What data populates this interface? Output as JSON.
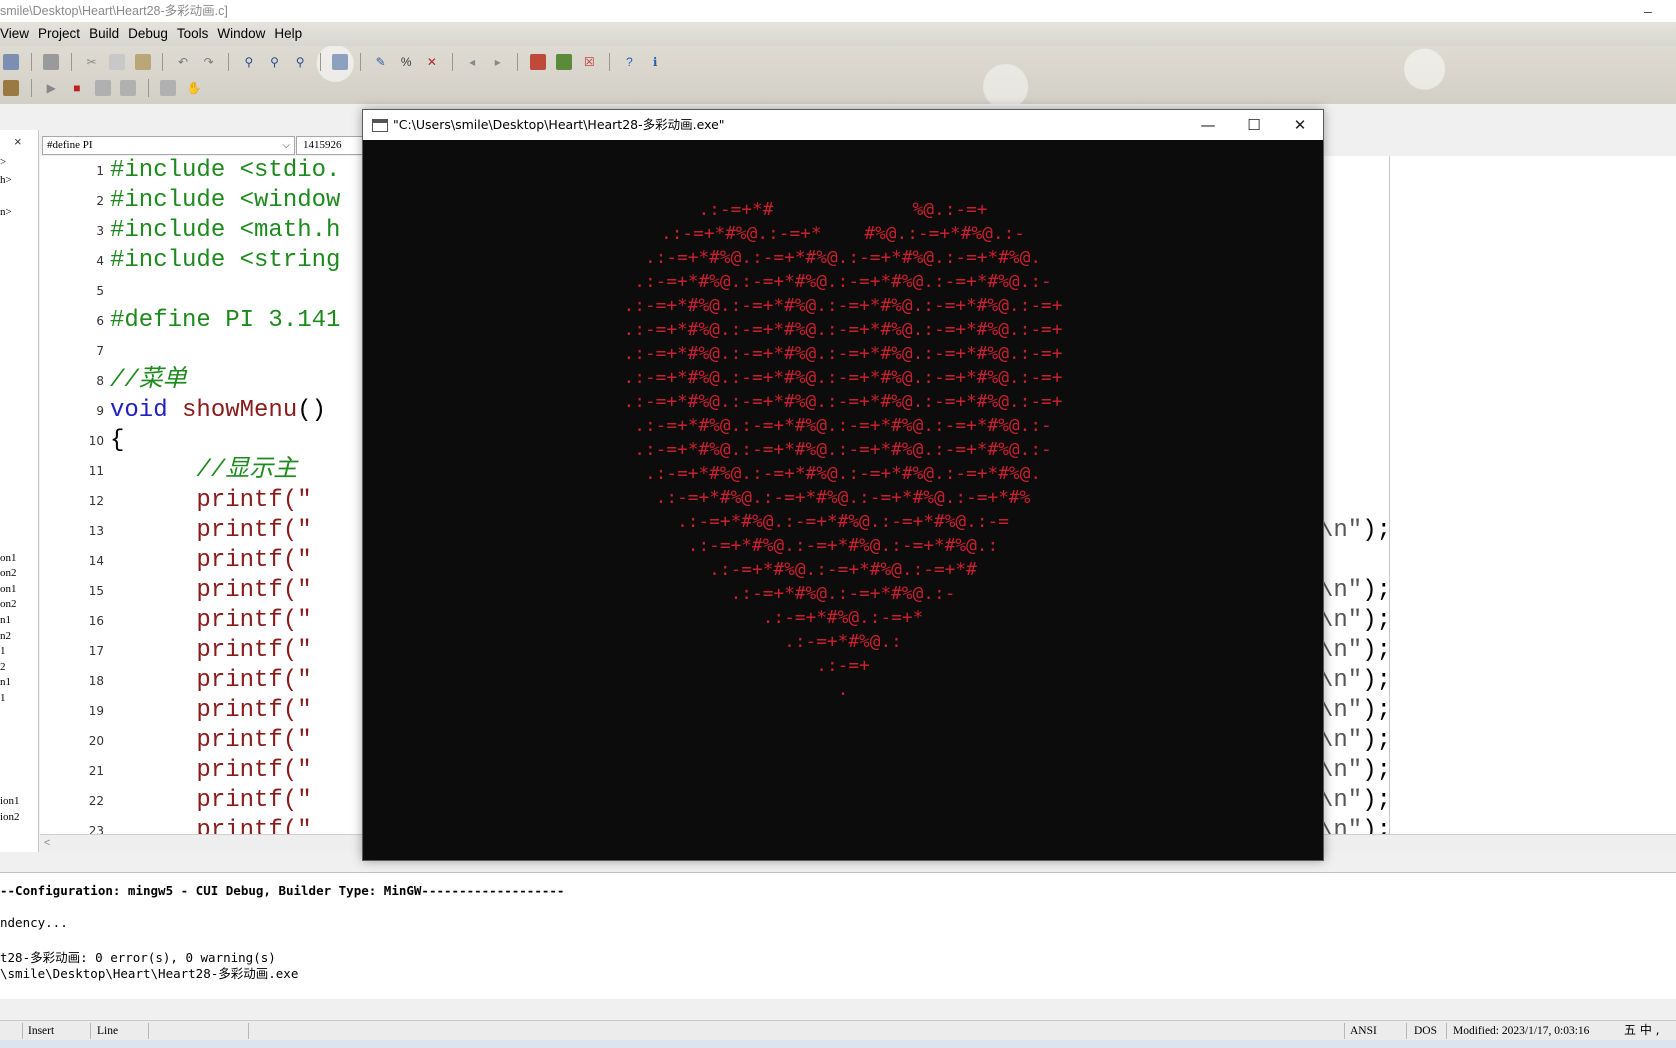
{
  "app": {
    "title_fragment": "smile\\Desktop\\Heart\\Heart28-多彩动画.c]",
    "minimize_glyph": "–"
  },
  "menu": [
    "View",
    "Project",
    "Build",
    "Debug",
    "Tools",
    "Window",
    "Help"
  ],
  "colors": {
    "console_bg": "#0c0c0c",
    "heart_red": "#c8202e",
    "preprocessor_green": "#1e8a1e",
    "keyword_blue": "#2020c0",
    "function_red": "#8b1a1a"
  },
  "left_panel": {
    "close_glyph": "×",
    "items": [
      ">",
      "h>",
      "n>",
      "on1",
      "on2",
      "on1",
      "on2",
      "n1",
      "n2",
      "1",
      "2",
      "n1",
      "1",
      "ion1",
      "ion2"
    ]
  },
  "codebar": {
    "define_selector": "#define PI",
    "value_box": "1415926"
  },
  "code_lines": [
    {
      "n": "1",
      "text": "#include <stdio.",
      "kind": "pre"
    },
    {
      "n": "2",
      "text": "#include <window",
      "kind": "pre"
    },
    {
      "n": "3",
      "text": "#include <math.h",
      "kind": "pre"
    },
    {
      "n": "4",
      "text": "#include <string",
      "kind": "pre"
    },
    {
      "n": "5",
      "text": "",
      "kind": "plain"
    },
    {
      "n": "6",
      "text": "#define PI 3.141",
      "kind": "pre"
    },
    {
      "n": "7",
      "text": "",
      "kind": "plain"
    },
    {
      "n": "8",
      "text": "//菜单",
      "kind": "comment"
    },
    {
      "n": "9",
      "kw": "void",
      "fn": " showMenu",
      "rest": "()",
      "kind": "decl"
    },
    {
      "n": "10",
      "text": "{",
      "kind": "plain"
    },
    {
      "n": "11",
      "text": "      //显示主",
      "kind": "comment"
    },
    {
      "n": "12",
      "text": "      printf(\"",
      "kind": "call"
    },
    {
      "n": "13",
      "text": "      printf(\"",
      "kind": "call"
    },
    {
      "n": "14",
      "text": "      printf(\"",
      "kind": "call"
    },
    {
      "n": "15",
      "text": "      printf(\"",
      "kind": "call"
    },
    {
      "n": "16",
      "text": "      printf(\"",
      "kind": "call"
    },
    {
      "n": "17",
      "text": "      printf(\"",
      "kind": "call"
    },
    {
      "n": "18",
      "text": "      printf(\"",
      "kind": "call"
    },
    {
      "n": "19",
      "text": "      printf(\"",
      "kind": "call"
    },
    {
      "n": "20",
      "text": "      printf(\"",
      "kind": "call"
    },
    {
      "n": "21",
      "text": "      printf(\"",
      "kind": "call"
    },
    {
      "n": "22",
      "text": "      printf(\"",
      "kind": "call"
    },
    {
      "n": "23",
      "text": "      printf(\"",
      "kind": "call"
    }
  ],
  "code_tails": [
    {
      "line": "13",
      "str": "=======\\n\"",
      "end": ");"
    },
    {
      "line": "15",
      "str": "******\\n\"",
      "end": ");"
    },
    {
      "line": "16",
      "str": "$\\n\"",
      "end": ");"
    },
    {
      "line": "17",
      "str": "$\\n\"",
      "end": ");"
    },
    {
      "line": "18",
      "str": "$\\n\"",
      "end": ");"
    },
    {
      "line": "19",
      "str": "$\\n\"",
      "end": ");"
    },
    {
      "line": "20",
      "str": "$\\n\"",
      "end": ");"
    },
    {
      "line": "21",
      "str": "$\\n\"",
      "end": ");"
    },
    {
      "line": "22",
      "str": "$\\n\"",
      "end": ");"
    },
    {
      "line": "23",
      "str": "$\\n\"",
      "end": ");"
    }
  ],
  "console": {
    "title": "\"C:\\Users\\smile\\Desktop\\Heart\\Heart28-多彩动画.exe\"",
    "minimize": "—",
    "maximize": "☐",
    "close": "✕",
    "heart_lines": [
      ".:-=+*#             %@.:-=+",
      ".:-=+*#%@.:-=+*    #%@.:-=+*#%@.:-",
      ".:-=+*#%@.:-=+*#%@.:-=+*#%@.:-=+*#%@.",
      ".:-=+*#%@.:-=+*#%@.:-=+*#%@.:-=+*#%@.:-",
      ".:-=+*#%@.:-=+*#%@.:-=+*#%@.:-=+*#%@.:-=+",
      ".:-=+*#%@.:-=+*#%@.:-=+*#%@.:-=+*#%@.:-=+",
      ".:-=+*#%@.:-=+*#%@.:-=+*#%@.:-=+*#%@.:-=+",
      ".:-=+*#%@.:-=+*#%@.:-=+*#%@.:-=+*#%@.:-=+",
      ".:-=+*#%@.:-=+*#%@.:-=+*#%@.:-=+*#%@.:-=+",
      ".:-=+*#%@.:-=+*#%@.:-=+*#%@.:-=+*#%@.:-",
      ".:-=+*#%@.:-=+*#%@.:-=+*#%@.:-=+*#%@.:-",
      ".:-=+*#%@.:-=+*#%@.:-=+*#%@.:-=+*#%@.",
      ".:-=+*#%@.:-=+*#%@.:-=+*#%@.:-=+*#%",
      ".:-=+*#%@.:-=+*#%@.:-=+*#%@.:-=",
      ".:-=+*#%@.:-=+*#%@.:-=+*#%@.:",
      ".:-=+*#%@.:-=+*#%@.:-=+*#",
      ".:-=+*#%@.:-=+*#%@.:-",
      ".:-=+*#%@.:-=+*",
      ".:-=+*#%@.:",
      ".:-=+",
      "."
    ]
  },
  "output": {
    "lines": [
      {
        "text": "--Configuration: mingw5 - CUI Debug, Builder Type: MinGW-------------------",
        "bold": true
      },
      {
        "text": "",
        "bold": false
      },
      {
        "text": "ndency...",
        "bold": false
      },
      {
        "text": "",
        "bold": false
      },
      {
        "text": "t28-多彩动画: 0 error(s), 0 warning(s)",
        "bold": false
      },
      {
        "text": "\\smile\\Desktop\\Heart\\Heart28-多彩动画.exe",
        "bold": false
      }
    ]
  },
  "status": {
    "insert": "Insert",
    "line": "Line",
    "encoding": "ANSI",
    "eol": "DOS",
    "modified": "Modified: 2023/1/17, 0:03:16",
    "ime": "五 中 ,"
  },
  "scroll": {
    "left_arrow": "<"
  }
}
